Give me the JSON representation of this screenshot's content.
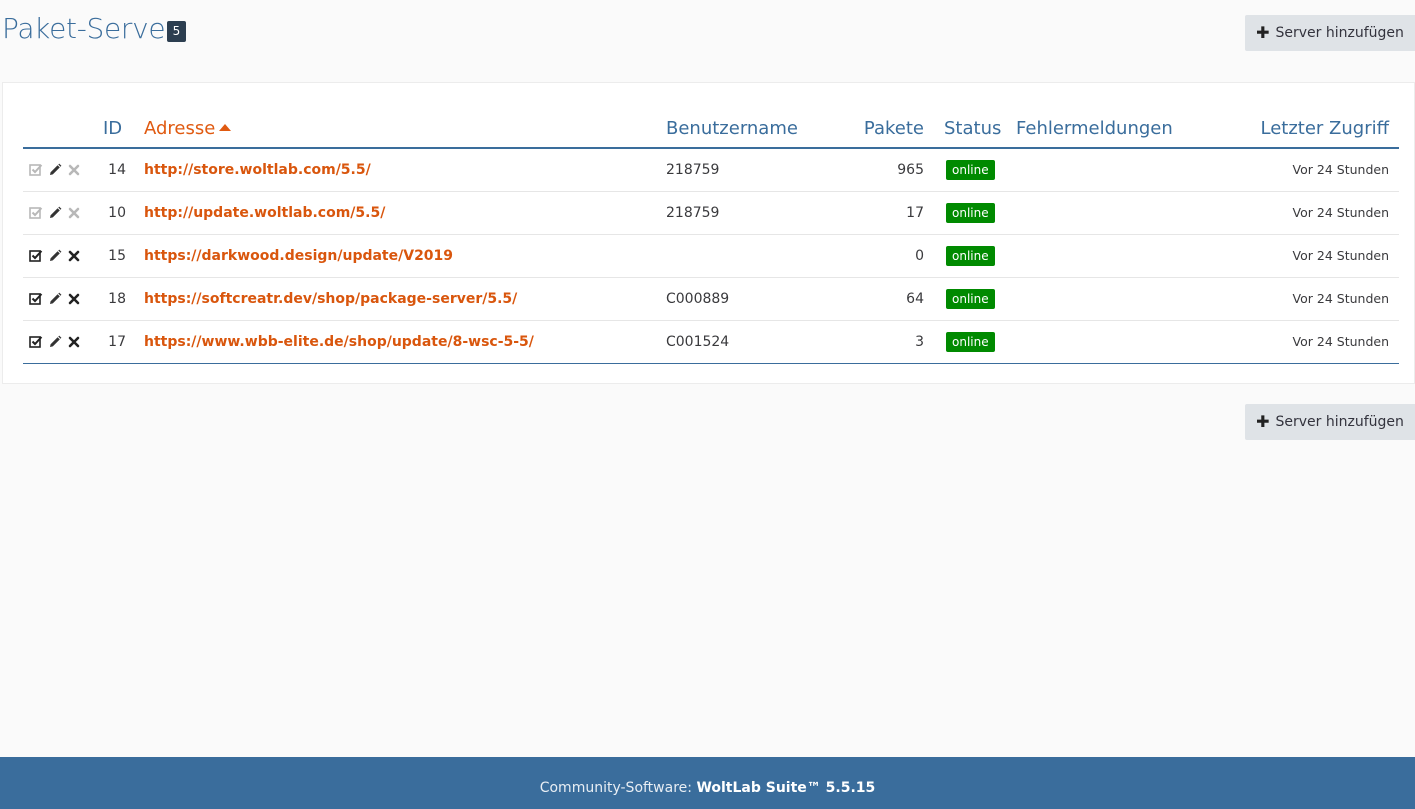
{
  "header": {
    "title": "Paket-Server",
    "count_badge": "5",
    "add_button_label": "Server hinzufügen"
  },
  "table": {
    "columns": {
      "id": "ID",
      "address": "Adresse",
      "username": "Benutzername",
      "packages": "Pakete",
      "status": "Status",
      "errors": "Fehlermeldungen",
      "last_access": "Letzter Zugriff"
    },
    "sorted_column": "address",
    "rows": [
      {
        "id": "14",
        "address": "http://store.woltlab.com/5.5/",
        "username": "218759",
        "packages": "965",
        "status": "online",
        "errors": "",
        "last_access": "Vor 24 Stunden",
        "actions_enabled": false
      },
      {
        "id": "10",
        "address": "http://update.woltlab.com/5.5/",
        "username": "218759",
        "packages": "17",
        "status": "online",
        "errors": "",
        "last_access": "Vor 24 Stunden",
        "actions_enabled": false
      },
      {
        "id": "15",
        "address": "https://darkwood.design/update/V2019",
        "username": "",
        "packages": "0",
        "status": "online",
        "errors": "",
        "last_access": "Vor 24 Stunden",
        "actions_enabled": true
      },
      {
        "id": "18",
        "address": "https://softcreatr.dev/shop/package-server/5.5/",
        "username": "C000889",
        "packages": "64",
        "status": "online",
        "errors": "",
        "last_access": "Vor 24 Stunden",
        "actions_enabled": true
      },
      {
        "id": "17",
        "address": "https://www.wbb-elite.de/shop/update/8-wsc-5-5/",
        "username": "C001524",
        "packages": "3",
        "status": "online",
        "errors": "",
        "last_access": "Vor 24 Stunden",
        "actions_enabled": true
      }
    ]
  },
  "footer": {
    "prefix": "Community-Software: ",
    "product": "WoltLab Suite™ 5.5.15"
  },
  "colors": {
    "accent": "#3a6d9c",
    "link": "#d9560d",
    "status_online": "#008a00"
  },
  "icons": {
    "toggle": "check-square-icon",
    "edit": "pencil-icon",
    "delete": "times-icon",
    "add": "plus-icon"
  }
}
